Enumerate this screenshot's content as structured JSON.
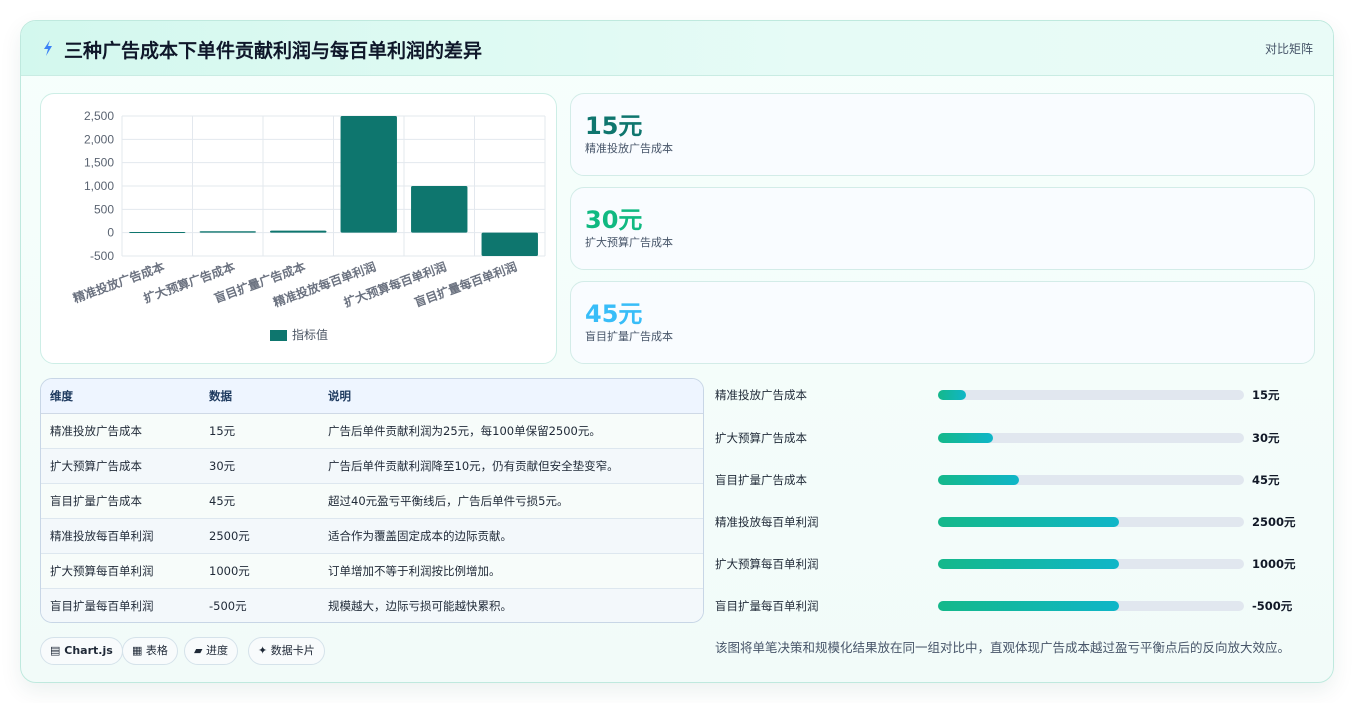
{
  "header": {
    "title": "三种广告成本下单件贡献利润与每百单利润的差异",
    "mode": "对比矩阵"
  },
  "chart_data": {
    "type": "bar",
    "categories": [
      "精准投放广告成本",
      "扩大预算广告成本",
      "盲目扩量广告成本",
      "精准投放每百单利润",
      "扩大预算每百单利润",
      "盲目扩量每百单利润"
    ],
    "series": [
      {
        "name": "指标值",
        "values": [
          15,
          30,
          45,
          2500,
          1000,
          -500
        ]
      }
    ],
    "yticks": [
      "2,500",
      "2,000",
      "1,500",
      "1,000",
      "500",
      "0",
      "-500"
    ],
    "ylim": [
      -500,
      2500
    ],
    "grid": true,
    "legend": "bottom",
    "color": "#0e766e"
  },
  "stats": [
    {
      "value": "15元",
      "label": "精准投放广告成本",
      "color": "#0f766e"
    },
    {
      "value": "30元",
      "label": "扩大预算广告成本",
      "color": "#10b981"
    },
    {
      "value": "45元",
      "label": "盲目扩量广告成本",
      "color": "#38bdf8"
    }
  ],
  "table": {
    "headers": [
      "维度",
      "数据",
      "说明"
    ],
    "rows": [
      [
        "精准投放广告成本",
        "15元",
        "广告后单件贡献利润为25元，每100单保留2500元。"
      ],
      [
        "扩大预算广告成本",
        "30元",
        "广告后单件贡献利润降至10元，仍有贡献但安全垫变窄。"
      ],
      [
        "盲目扩量广告成本",
        "45元",
        "超过40元盈亏平衡线后，广告后单件亏损5元。"
      ],
      [
        "精准投放每百单利润",
        "2500元",
        "适合作为覆盖固定成本的边际贡献。"
      ],
      [
        "扩大预算每百单利润",
        "1000元",
        "订单增加不等于利润按比例增加。"
      ],
      [
        "盲目扩量每百单利润",
        "-500元",
        "规模越大，边际亏损可能越快累积。"
      ]
    ]
  },
  "progress": [
    {
      "label": "精准投放广告成本",
      "value": "15元",
      "fraction": 0.09
    },
    {
      "label": "扩大预算广告成本",
      "value": "30元",
      "fraction": 0.18
    },
    {
      "label": "盲目扩量广告成本",
      "value": "45元",
      "fraction": 0.265
    },
    {
      "label": "精准投放每百单利润",
      "value": "2500元",
      "fraction": 0.59
    },
    {
      "label": "扩大预算每百单利润",
      "value": "1000元",
      "fraction": 0.59
    },
    {
      "label": "盲目扩量每百单利润",
      "value": "-500元",
      "fraction": 0.59
    }
  ],
  "chips": [
    {
      "icon": "▤",
      "label": "Chart.js",
      "bold": true
    },
    {
      "icon": "▦",
      "label": "表格"
    },
    {
      "icon": "▰",
      "label": "进度"
    },
    {
      "icon": "✦",
      "label": "数据卡片"
    }
  ],
  "footnote": "该图将单笔决策和规模化结果放在同一组对比中，直观体现广告成本越过盈亏平衡点后的反向放大效应。"
}
